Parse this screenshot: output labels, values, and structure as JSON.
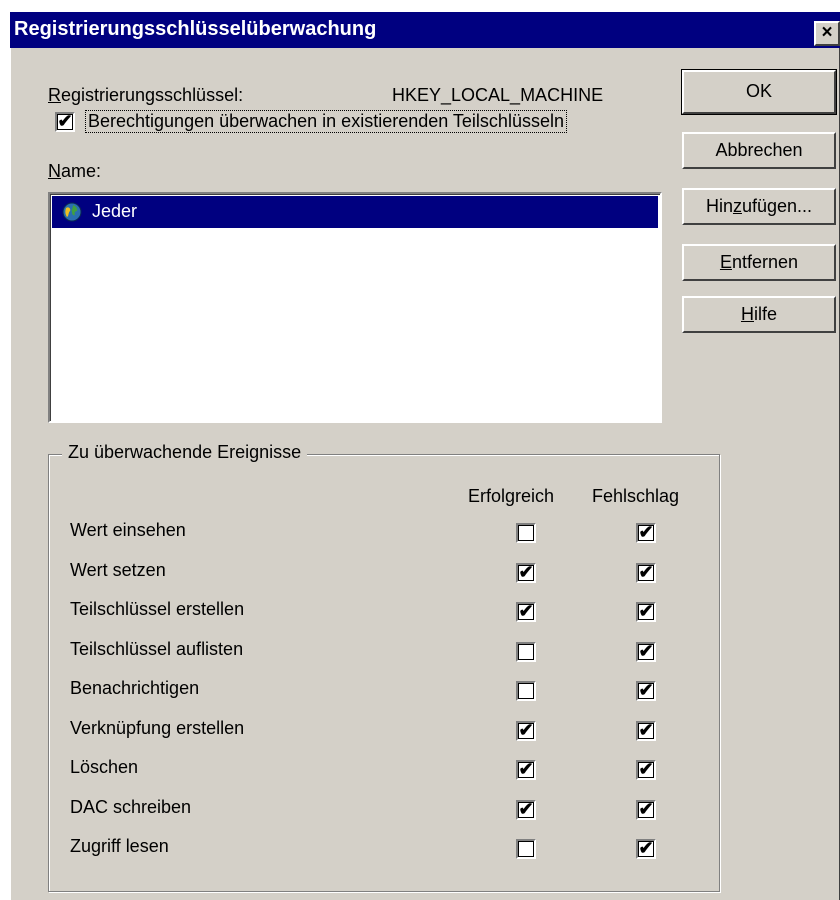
{
  "window": {
    "title": "Registrierungsschlüsselüberwachung",
    "close_label": "×"
  },
  "key": {
    "label_accel": "R",
    "label_rest": "egistrierungsschlüssel:",
    "value": "HKEY_LOCAL_MACHINE"
  },
  "subkeys_option": {
    "label": "Berechtigungen überwachen in existierenden Teilschlüsseln",
    "checked": true
  },
  "names": {
    "label_accel": "N",
    "label_rest": "ame:",
    "items": [
      {
        "label": "Jeder",
        "icon": "globe-icon",
        "selected": true
      }
    ]
  },
  "buttons": {
    "ok": "OK",
    "cancel": "Abbrechen",
    "add_pre": "Hin",
    "add_accel": "z",
    "add_post": "ufügen...",
    "remove_accel": "E",
    "remove_rest": "ntfernen",
    "help_accel": "H",
    "help_rest": "ilfe"
  },
  "events": {
    "group_title": "Zu überwachende Ereignisse",
    "col_success": "Erfolgreich",
    "col_failure": "Fehlschlag",
    "rows": [
      {
        "label": "Wert einsehen",
        "success": false,
        "failure": true
      },
      {
        "label": "Wert setzen",
        "success": true,
        "failure": true
      },
      {
        "label": "Teilschlüssel erstellen",
        "success": true,
        "failure": true
      },
      {
        "label": "Teilschlüssel auflisten",
        "success": false,
        "failure": true
      },
      {
        "label": "Benachrichtigen",
        "success": false,
        "failure": true
      },
      {
        "label": "Verknüpfung erstellen",
        "success": true,
        "failure": true
      },
      {
        "label": "Löschen",
        "success": true,
        "failure": true
      },
      {
        "label": "DAC schreiben",
        "success": true,
        "failure": true
      },
      {
        "label": "Zugriff lesen",
        "success": false,
        "failure": true
      }
    ]
  },
  "colors": {
    "titlebar": "#000080",
    "dialog_face": "#d4d0c8",
    "selection": "#000080"
  },
  "check_mark": "✔"
}
